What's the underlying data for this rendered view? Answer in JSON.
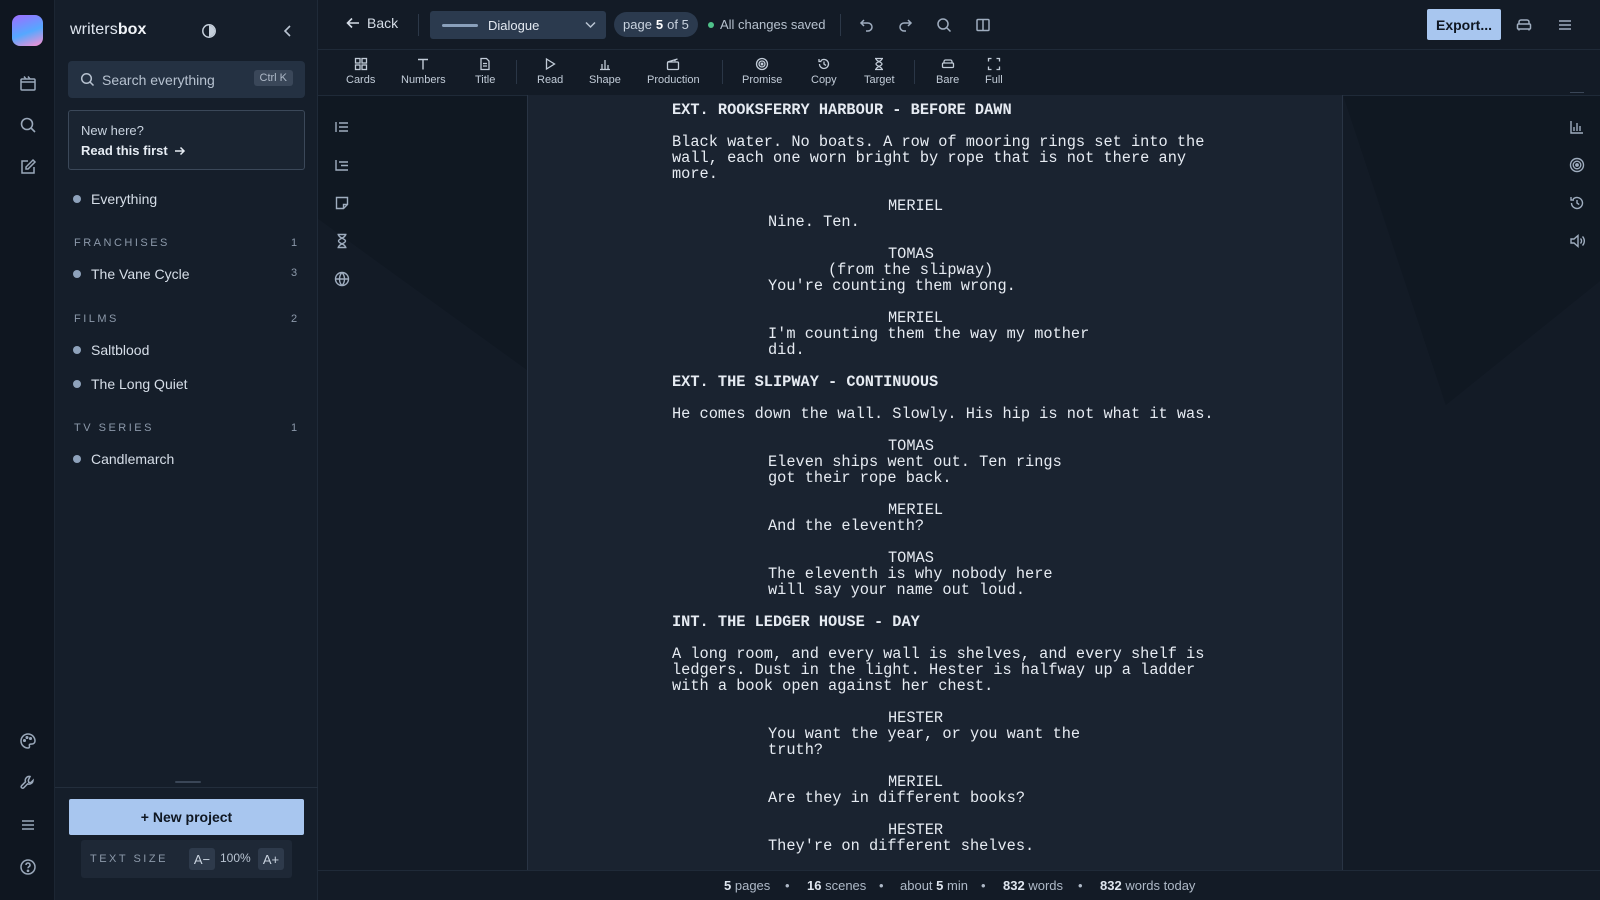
{
  "app": {
    "brand_light": "writers",
    "brand_bold": "box"
  },
  "sidebar": {
    "search_placeholder": "Search everything",
    "search_shortcut": "Ctrl K",
    "new_here": "New here?",
    "read_first": "Read this first",
    "everything": "Everything",
    "sections": [
      {
        "title": "FRANCHISES",
        "count": "1",
        "items": [
          {
            "label": "The Vane Cycle",
            "count": "3"
          }
        ]
      },
      {
        "title": "FILMS",
        "count": "2",
        "items": [
          {
            "label": "Saltblood"
          },
          {
            "label": "The Long Quiet"
          }
        ]
      },
      {
        "title": "TV SERIES",
        "count": "1",
        "items": [
          {
            "label": "Candlemarch"
          }
        ]
      }
    ],
    "new_project": "+ New project",
    "text_size_label": "TEXT SIZE",
    "text_size_decrease": "A−",
    "text_size_value": "100%",
    "text_size_increase": "A+"
  },
  "topbar": {
    "back": "Back",
    "element_type": "Dialogue",
    "page_prefix": "page",
    "page_current": "5",
    "page_suffix": "of 5",
    "save_status": "All changes saved",
    "export": "Export..."
  },
  "tools": [
    "Cards",
    "Numbers",
    "Title",
    "Read",
    "Shape",
    "Production",
    "Promise",
    "Copy",
    "Target",
    "Bare",
    "Full"
  ],
  "script": [
    {
      "type": "slug",
      "text": "EXT. ROOKSFERRY HARBOUR - BEFORE DAWN"
    },
    {
      "type": "action",
      "text": "Black water. No boats. A row of mooring rings set into the\nwall, each one worn bright by rope that is not there any\nmore."
    },
    {
      "type": "char",
      "text": "MERIEL"
    },
    {
      "type": "dialogue",
      "text": "Nine. Ten."
    },
    {
      "type": "char",
      "text": "TOMAS"
    },
    {
      "type": "paren",
      "text": "(from the slipway)"
    },
    {
      "type": "dialogue",
      "text": "You're counting them wrong."
    },
    {
      "type": "char",
      "text": "MERIEL"
    },
    {
      "type": "dialogue",
      "text": "I'm counting them the way my mother\ndid."
    },
    {
      "type": "slug",
      "text": "EXT. THE SLIPWAY - CONTINUOUS"
    },
    {
      "type": "action",
      "text": "He comes down the wall. Slowly. His hip is not what it was."
    },
    {
      "type": "char",
      "text": "TOMAS"
    },
    {
      "type": "dialogue",
      "text": "Eleven ships went out. Ten rings\ngot their rope back."
    },
    {
      "type": "char",
      "text": "MERIEL"
    },
    {
      "type": "dialogue",
      "text": "And the eleventh?"
    },
    {
      "type": "char",
      "text": "TOMAS"
    },
    {
      "type": "dialogue",
      "text": "The eleventh is why nobody here\nwill say your name out loud."
    },
    {
      "type": "slug",
      "text": "INT. THE LEDGER HOUSE - DAY"
    },
    {
      "type": "action",
      "text": "A long room, and every wall is shelves, and every shelf is\nledgers. Dust in the light. Hester is halfway up a ladder\nwith a book open against her chest."
    },
    {
      "type": "char",
      "text": "HESTER"
    },
    {
      "type": "dialogue",
      "text": "You want the year, or you want the\ntruth?"
    },
    {
      "type": "char",
      "text": "MERIEL"
    },
    {
      "type": "dialogue",
      "text": "Are they in different books?"
    },
    {
      "type": "char",
      "text": "HESTER"
    },
    {
      "type": "dialogue",
      "text": "They're on different shelves."
    }
  ],
  "status": {
    "pages_num": "5",
    "pages_label": "pages",
    "scenes_num": "16",
    "scenes_label": "scenes",
    "time_pre": "about",
    "time_num": "5",
    "time_label": "min",
    "words_num": "832",
    "words_label": "words",
    "today_num": "832",
    "today_label": "words today"
  }
}
